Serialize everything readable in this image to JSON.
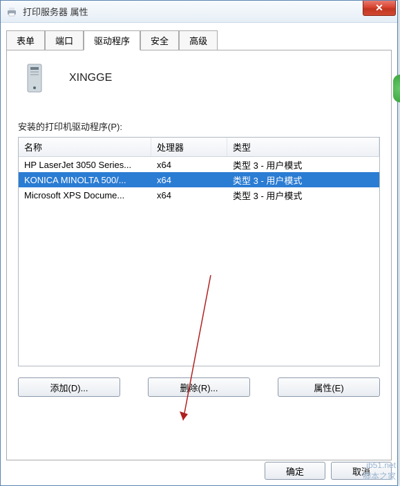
{
  "window": {
    "title": "打印服务器 属性",
    "close_glyph": "✕"
  },
  "tabs": [
    {
      "label": "表单"
    },
    {
      "label": "端口"
    },
    {
      "label": "驱动程序"
    },
    {
      "label": "安全"
    },
    {
      "label": "高级"
    }
  ],
  "server": {
    "name": "XINGGE"
  },
  "list": {
    "caption": "安装的打印机驱动程序(P):",
    "columns": {
      "name": "名称",
      "processor": "处理器",
      "type": "类型"
    },
    "rows": [
      {
        "name": "HP LaserJet 3050 Series...",
        "processor": "x64",
        "type": "类型 3 - 用户模式",
        "selected": false
      },
      {
        "name": "KONICA MINOLTA 500/...",
        "processor": "x64",
        "type": "类型 3 - 用户模式",
        "selected": true
      },
      {
        "name": "Microsoft XPS Docume...",
        "processor": "x64",
        "type": "类型 3 - 用户模式",
        "selected": false
      }
    ]
  },
  "buttons": {
    "add": "添加(D)...",
    "remove": "删除(R)...",
    "props": "属性(E)"
  },
  "footer": {
    "ok": "确定",
    "cancel": "取消"
  },
  "watermark": "jb51.net\n脚本之家"
}
